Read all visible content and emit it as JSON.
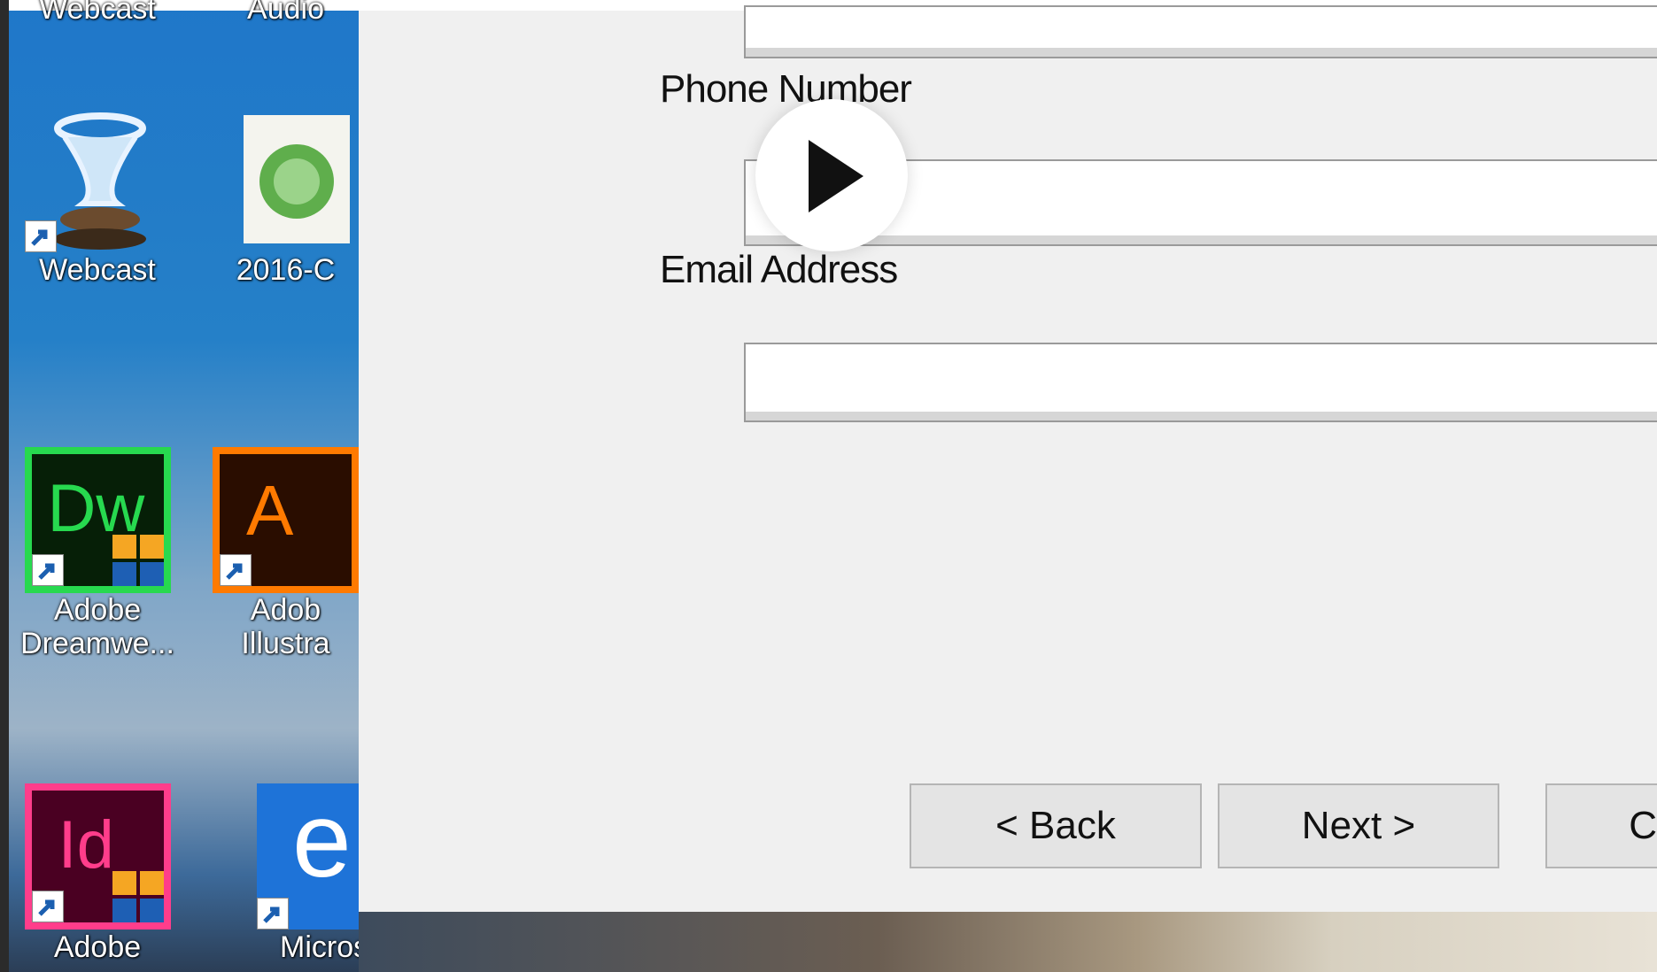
{
  "desktop": {
    "icons": [
      {
        "id": "top1",
        "label": "Webcast"
      },
      {
        "id": "top2",
        "label": "Audio"
      },
      {
        "id": "hourglass",
        "label": "Webcast"
      },
      {
        "id": "money",
        "label": "2016-C"
      },
      {
        "id": "dw",
        "label": "Adobe\nDreamwe...",
        "glyph": "Dw"
      },
      {
        "id": "ai",
        "label": "Adob\nIllustra",
        "glyph": "A"
      },
      {
        "id": "id",
        "label": "Adobe",
        "glyph": "Id"
      },
      {
        "id": "edge",
        "label": "Microsoft",
        "glyph": "e"
      }
    ]
  },
  "dialog": {
    "phone_label": "Phone Number",
    "email_label": "Email Address",
    "phone_value": "",
    "email_value": "",
    "back_label": "< Back",
    "next_label": "Next >",
    "cancel_label": "C"
  },
  "colors": {
    "dw_green": "#27d94f",
    "ai_orange": "#ff7a00",
    "id_pink": "#ff3d8b",
    "edge_blue": "#1e73d8"
  }
}
